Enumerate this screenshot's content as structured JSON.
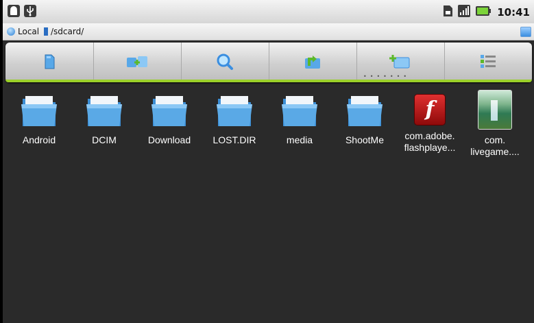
{
  "status_bar": {
    "time": "10:41",
    "left_icons": [
      "android-debug-icon",
      "usb-icon"
    ],
    "right_icons": [
      "sd-card-icon",
      "signal-icon",
      "battery-icon"
    ]
  },
  "path_bar": {
    "crumbs": [
      "Local",
      "/sdcard/"
    ]
  },
  "toolbar": {
    "buttons": [
      "sdcard-icon",
      "copy-multiple-icon",
      "search-icon",
      "up-folder-icon",
      "new-folder-icon",
      "list-view-icon"
    ]
  },
  "files": [
    {
      "line1": "Android",
      "line2": "",
      "icon": "folder-icon"
    },
    {
      "line1": "DCIM",
      "line2": "",
      "icon": "folder-icon"
    },
    {
      "line1": "Download",
      "line2": "",
      "icon": "folder-icon"
    },
    {
      "line1": "LOST.DIR",
      "line2": "",
      "icon": "folder-icon"
    },
    {
      "line1": "media",
      "line2": "",
      "icon": "folder-icon"
    },
    {
      "line1": "ShootMe",
      "line2": "",
      "icon": "folder-icon"
    },
    {
      "line1": "com.adobe.",
      "line2": "flashplaye...",
      "icon": "flash-apk-icon",
      "glyph": "f"
    },
    {
      "line1": "com.",
      "line2": "livegame....",
      "icon": "image-thumbnail-icon"
    }
  ],
  "colors": {
    "accent": "#9bd02a",
    "background": "#2a2a2a",
    "folder": "#5aa9e6"
  }
}
